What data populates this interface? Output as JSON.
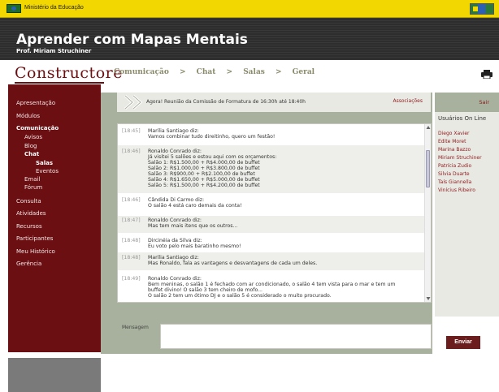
{
  "gov_bar": {
    "label": "Ministério da Educação"
  },
  "header": {
    "title": "Aprender com Mapas Mentais",
    "subtitle": "Prof. Miriam Struchiner"
  },
  "logo": {
    "text": "Constructore"
  },
  "breadcrumb": {
    "items": [
      "Comunicação",
      ">",
      "Chat",
      ">",
      "Salas",
      ">",
      "Geral"
    ]
  },
  "sidebar": {
    "items": [
      {
        "label": "Apresentação",
        "level": 0
      },
      {
        "label": "Módulos",
        "level": 0
      },
      {
        "label": "Comunicação",
        "level": 0,
        "active": true
      },
      {
        "label": "Avisos",
        "level": 1
      },
      {
        "label": "Blog",
        "level": 1
      },
      {
        "label": "Chat",
        "level": 1,
        "active": true
      },
      {
        "label": "Salas",
        "level": 2,
        "active": true
      },
      {
        "label": "Eventos",
        "level": 2
      },
      {
        "label": "Email",
        "level": 1
      },
      {
        "label": "Fórum",
        "level": 1
      },
      {
        "label": "Consulta",
        "level": 0
      },
      {
        "label": "Atividades",
        "level": 0
      },
      {
        "label": "Recursos",
        "level": 0
      },
      {
        "label": "Participantes",
        "level": 0
      },
      {
        "label": "Meu Histórico",
        "level": 0
      },
      {
        "label": "Gerência",
        "level": 0
      }
    ]
  },
  "notice": {
    "text": "Agora! Reunião da Comissão de Formatura de 16:30h até 18:40h",
    "link": "Associações"
  },
  "chat": {
    "messages": [
      {
        "time": "[18:45]",
        "author": "Marília Santiago diz:",
        "text": "Vamos combinar tudo direitinho, quero um festão!"
      },
      {
        "time": "[18:46]",
        "author": "Ronaldo Conrado diz:",
        "text": "Já visitei 5 salões e estou aqui com os orçamentos:\nSalão 1: R$1.500,00 + R$4.000,00 de buffet\nSalão 2: R$1.000,00 + R$3.800,00 de buffet\nSalão 3: R$900,00 + R$2.100,00 de buffet\nSalão 4: R$1.650,00 + R$5.000,00 de buffet\nSalão 5: R$1.500,00 + R$4.200,00 de buffet"
      },
      {
        "time": "[18:46]",
        "author": "Cândida Di Carmo diz:",
        "text": "O salão 4 está caro demais da conta!"
      },
      {
        "time": "[18:47]",
        "author": "Ronaldo Conrado diz:",
        "text": "Mas tem mais itens que os outros..."
      },
      {
        "time": "[18:48]",
        "author": "Dircinéia da Silva diz:",
        "text": "Eu voto pelo mais baratinho mesmo!"
      },
      {
        "time": "[18:48]",
        "author": "Marília Santiago diz:",
        "text": "Mas Ronaldo, fala as vantagens e desvantagens de cada um deles."
      },
      {
        "time": "[18:49]",
        "author": "Ronaldo Conrado diz:",
        "text": "Bem meninas, o salão 1 é fechado com ar condicionado, o salão 4 tem vista para o mar e tem um\nbuffet divino! O salão 3 tem cheiro de mofo...\nO salão 2 tem um ótimo DJ e o salão 5 é considerado o muito procurado."
      }
    ]
  },
  "compose": {
    "label": "Mensagem",
    "placeholder": ""
  },
  "send_button": {
    "label": "Enviar"
  },
  "right_panel": {
    "exit": "Sair",
    "title": "Usuários On Line",
    "users": [
      "Diego Xavier",
      "Edite Moret",
      "Marina Bazzo",
      "Miriam Struchiner",
      "Patrícia Zudio",
      "Silvia Duarte",
      "Taís Giannella",
      "Vinícius Ribeiro"
    ]
  },
  "colors": {
    "accent": "#6b0f12",
    "panel": "#a7b19d",
    "gov_yellow": "#f2d800"
  }
}
